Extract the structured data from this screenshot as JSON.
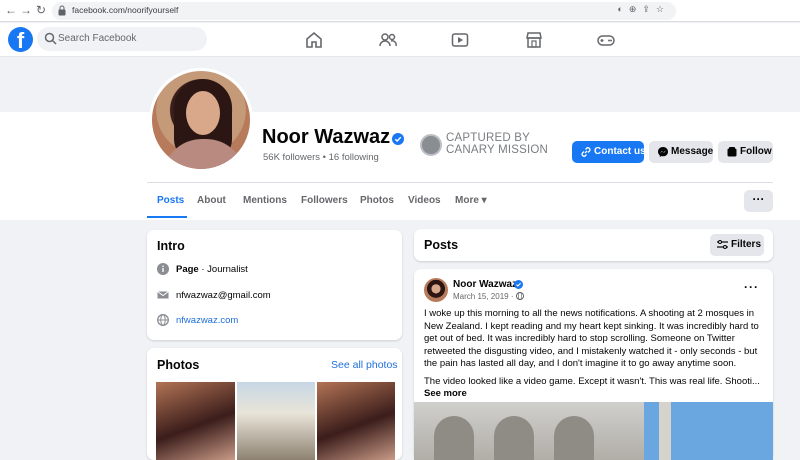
{
  "browser": {
    "url": "facebook.com/noorifyourself"
  },
  "fb_nav": {
    "logo": "f",
    "search_placeholder": "Search Facebook",
    "icons": [
      "home-icon",
      "friends-icon",
      "watch-icon",
      "marketplace-icon",
      "gaming-icon"
    ]
  },
  "profile": {
    "name": "Noor Wazwaz",
    "followers": "56K followers",
    "following": "16 following",
    "stats_sep": " • ",
    "canary_line1": "CAPTURED BY",
    "canary_line2": "CANARY MISSION",
    "contact_label": "Contact us",
    "message_label": "Message",
    "follow_label": "Follow",
    "more_label": "···"
  },
  "tabs": [
    {
      "label": "Posts",
      "active": true
    },
    {
      "label": "About"
    },
    {
      "label": "Mentions"
    },
    {
      "label": "Followers"
    },
    {
      "label": "Photos"
    },
    {
      "label": "Videos"
    },
    {
      "label": "More ▾"
    }
  ],
  "intro": {
    "title": "Intro",
    "page_label": "Page",
    "page_category": " · Journalist",
    "email": "nfwazwaz@gmail.com",
    "website": "nfwazwaz.com"
  },
  "photos": {
    "title": "Photos",
    "see_all": "See all photos"
  },
  "posts": {
    "title": "Posts",
    "filters_label": "Filters",
    "post": {
      "author": "Noor Wazwaz",
      "date": "March 15, 2019 ·",
      "para1": "I woke up this morning to all the news notifications. A shooting at 2 mosques in New Zealand. I kept reading and my heart kept sinking. It was incredibly hard to get out of bed. It was incredibly hard to stop scrolling. Someone on Twitter retweeted the disgusting video, and I mistakenly watched it - only seconds - but the pain has lasted all day, and I don't imagine it  to go away anytime soon.",
      "para2": "The video looked like a video game. Except it wasn't. This was real life. Shooti...",
      "see_more": "See more",
      "more_label": "···"
    }
  },
  "colors": {
    "brand": "#1877f2",
    "background": "#f0f2f5",
    "link": "#216fdb"
  }
}
